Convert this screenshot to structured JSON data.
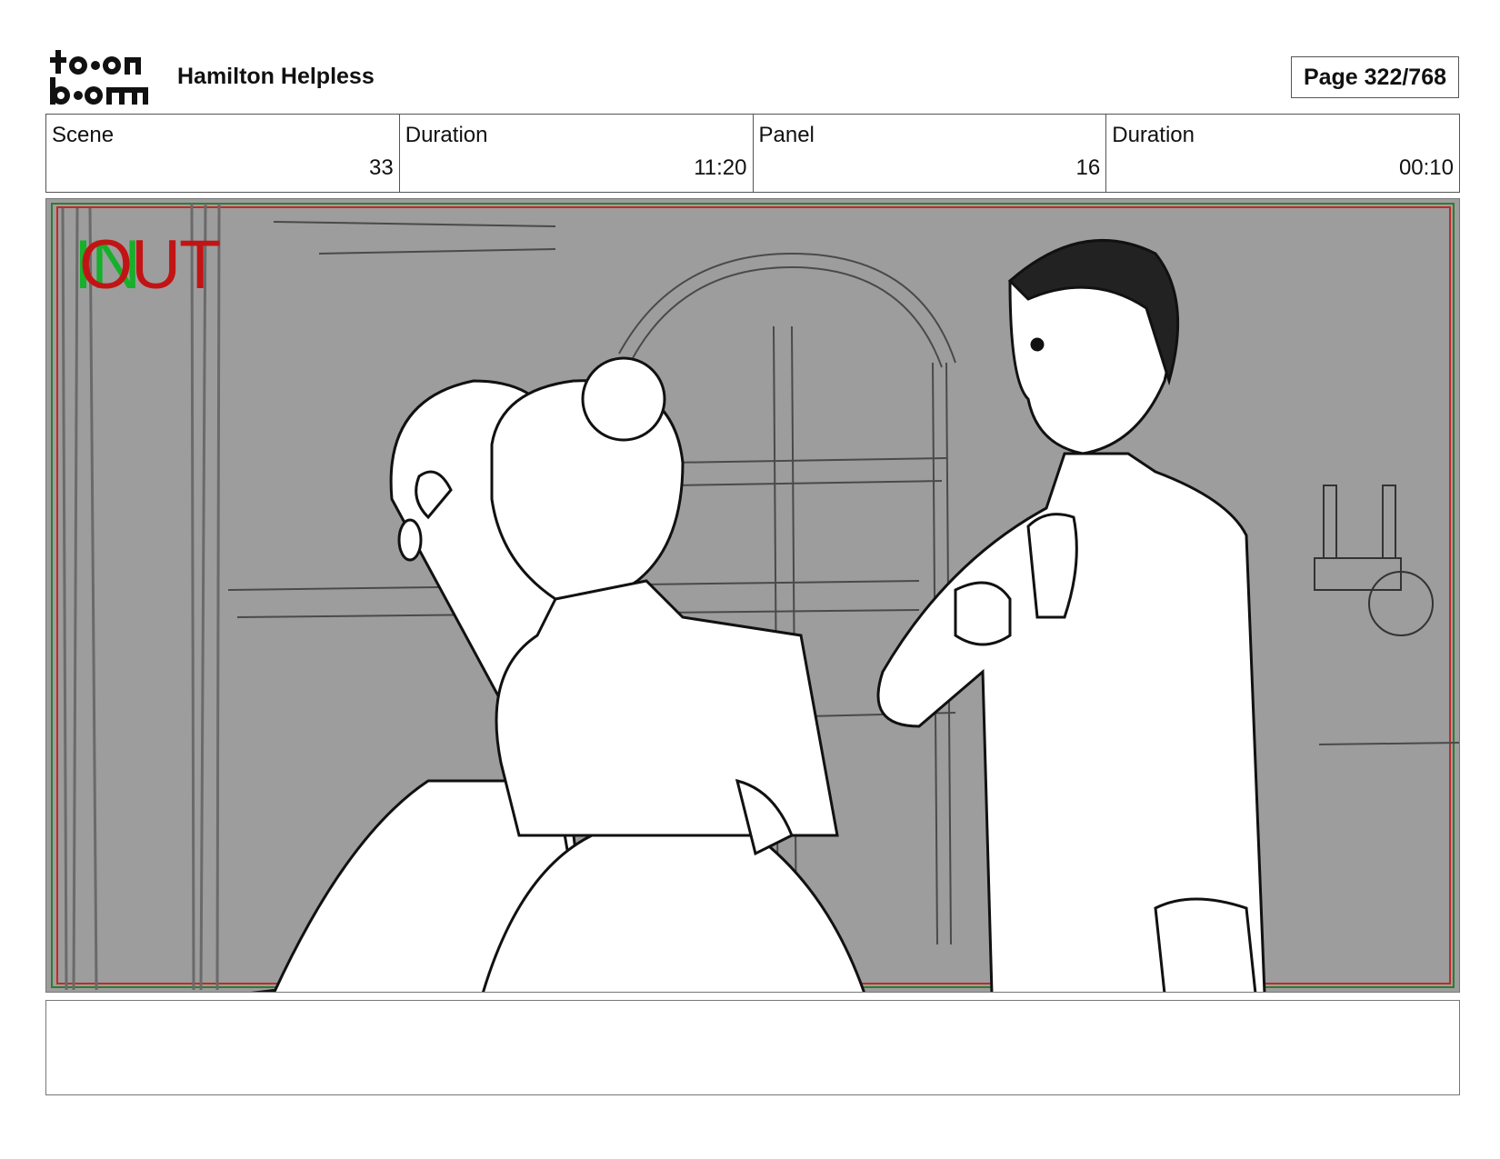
{
  "header": {
    "logo_text": "toon boom",
    "project_title": "Hamilton Helpless",
    "page_label": "Page 322/768"
  },
  "info": {
    "scene_label": "Scene",
    "scene_value": "33",
    "scene_duration_label": "Duration",
    "scene_duration_value": "11:20",
    "panel_label": "Panel",
    "panel_value": "16",
    "panel_duration_label": "Duration",
    "panel_duration_value": "00:10"
  },
  "panel": {
    "in_marker": "IN",
    "out_marker": "OUT"
  },
  "notes": {
    "text": ""
  }
}
